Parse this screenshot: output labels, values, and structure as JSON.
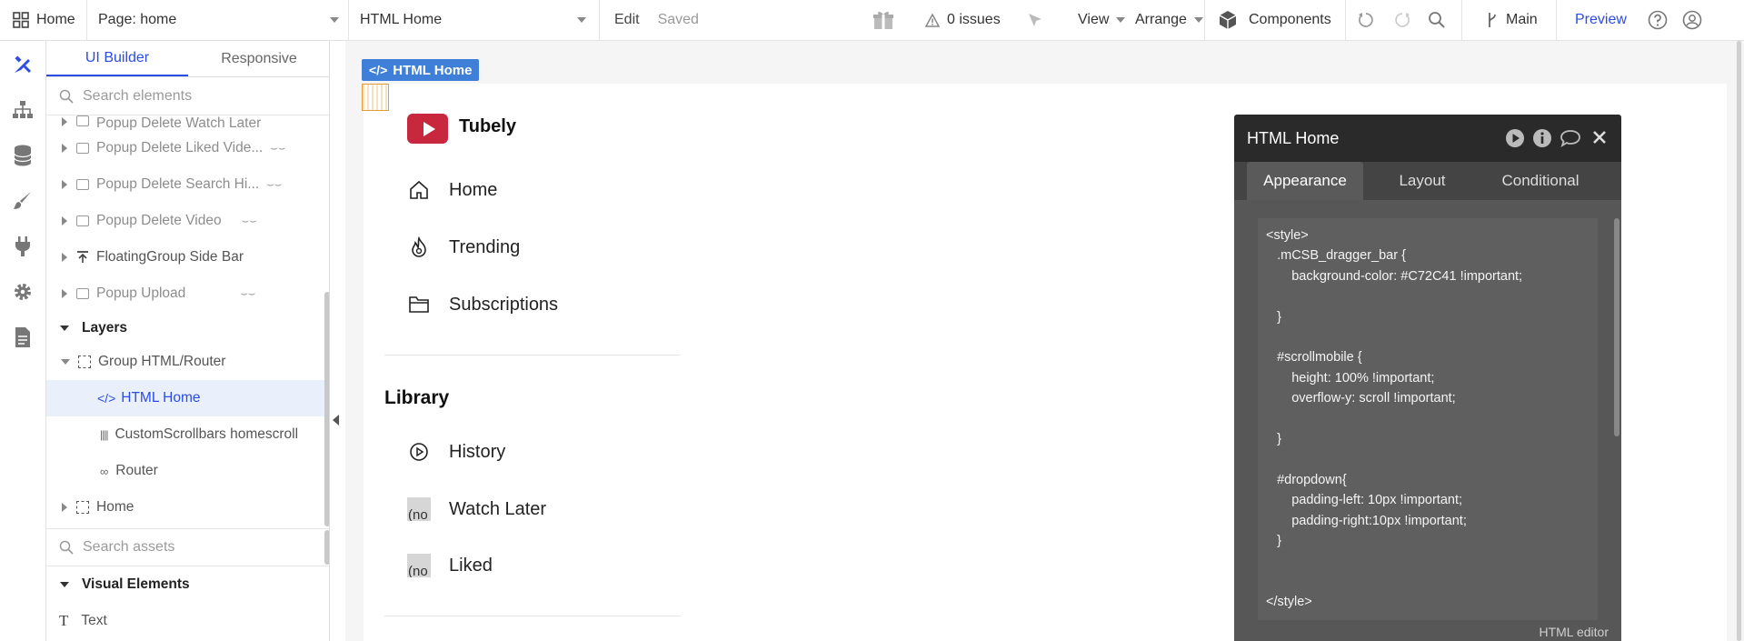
{
  "topbar": {
    "home_label": "Home",
    "page_label": "Page: home",
    "element_label": "HTML Home",
    "edit_label": "Edit",
    "saved_label": "Saved",
    "issues_label": "0 issues",
    "view_label": "View",
    "arrange_label": "Arrange",
    "components_label": "Components",
    "branch_label": "Main",
    "preview_label": "Preview"
  },
  "panel": {
    "tabs": [
      "UI Builder",
      "Responsive"
    ],
    "search_elements_placeholder": "Search elements",
    "tree": [
      {
        "label": "Popup Delete Watch Later",
        "dim": true
      },
      {
        "label": "Popup Delete Liked Vide...",
        "dim": true
      },
      {
        "label": "Popup Delete Search Hi...",
        "dim": true
      },
      {
        "label": "Popup Delete Video",
        "dim": true
      },
      {
        "label": "FloatingGroup Side Bar",
        "dim": false
      },
      {
        "label": "Popup Upload",
        "dim": true
      },
      {
        "label": "Layers",
        "dim": false
      },
      {
        "label": "Group HTML/Router",
        "dim": false
      },
      {
        "label": "HTML Home",
        "dim": false
      },
      {
        "label": "CustomScrollbars homescroll",
        "dim": false
      },
      {
        "label": "Router",
        "dim": false
      },
      {
        "label": "Home",
        "dim": false
      }
    ],
    "search_assets_placeholder": "Search assets",
    "visual_elements_label": "Visual Elements",
    "text_label": "Text"
  },
  "canvas": {
    "tag_label": "HTML Home",
    "brand": "Tubely",
    "nav": [
      "Home",
      "Trending",
      "Subscriptions"
    ],
    "library_title": "Library",
    "library": [
      "History",
      "Watch Later",
      "Liked"
    ],
    "placeholder_text": "(no",
    "brand_color": "#C72C41"
  },
  "editor": {
    "title": "HTML Home",
    "tabs": [
      "Appearance",
      "Layout",
      "Conditional"
    ],
    "code": "<style>\n   .mCSB_dragger_bar {\n       background-color: #C72C41 !important;\n\n   }\n\n   #scrollmobile {\n       height: 100% !important;\n       overflow-y: scroll !important;\n\n   }\n\n   #dropdown{\n       padding-left: 10px !important;\n       padding-right:10px !important;\n   }\n\n\n</style>",
    "footer": "HTML editor"
  }
}
